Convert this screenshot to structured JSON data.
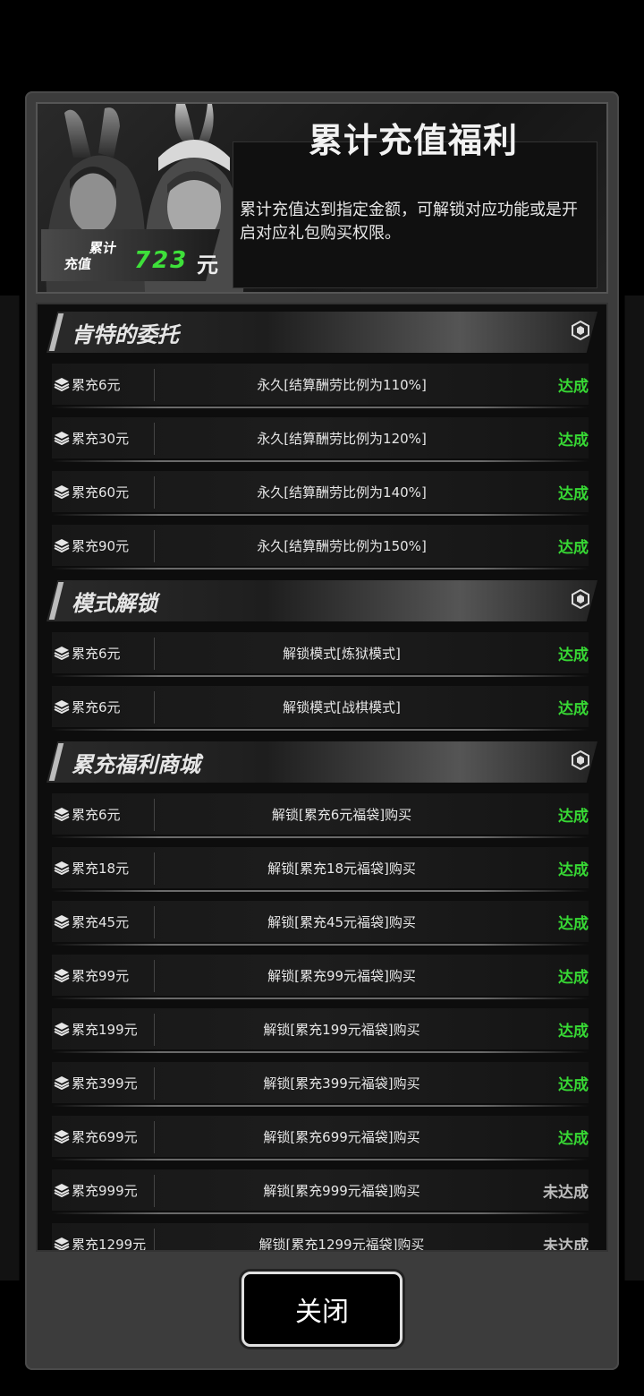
{
  "header": {
    "title": "累计充值福利",
    "description": "累计充值达到指定金额，可解锁对应功能或是开启对应礼包购买权限。",
    "badge_label_top": "累计",
    "badge_label_bottom": "充值",
    "badge_value": "723",
    "badge_unit": "元"
  },
  "sections": [
    {
      "title": "肯特的委托",
      "rows": [
        {
          "req": "累充6元",
          "desc": "永久[结算酬劳比例为110%]",
          "status": "达成",
          "done": true
        },
        {
          "req": "累充30元",
          "desc": "永久[结算酬劳比例为120%]",
          "status": "达成",
          "done": true
        },
        {
          "req": "累充60元",
          "desc": "永久[结算酬劳比例为140%]",
          "status": "达成",
          "done": true
        },
        {
          "req": "累充90元",
          "desc": "永久[结算酬劳比例为150%]",
          "status": "达成",
          "done": true
        }
      ]
    },
    {
      "title": "模式解锁",
      "rows": [
        {
          "req": "累充6元",
          "desc": "解锁模式[炼狱模式]",
          "status": "达成",
          "done": true
        },
        {
          "req": "累充6元",
          "desc": "解锁模式[战棋模式]",
          "status": "达成",
          "done": true
        }
      ]
    },
    {
      "title": "累充福利商城",
      "rows": [
        {
          "req": "累充6元",
          "desc": "解锁[累充6元福袋]购买",
          "status": "达成",
          "done": true
        },
        {
          "req": "累充18元",
          "desc": "解锁[累充18元福袋]购买",
          "status": "达成",
          "done": true
        },
        {
          "req": "累充45元",
          "desc": "解锁[累充45元福袋]购买",
          "status": "达成",
          "done": true
        },
        {
          "req": "累充99元",
          "desc": "解锁[累充99元福袋]购买",
          "status": "达成",
          "done": true
        },
        {
          "req": "累充199元",
          "desc": "解锁[累充199元福袋]购买",
          "status": "达成",
          "done": true
        },
        {
          "req": "累充399元",
          "desc": "解锁[累充399元福袋]购买",
          "status": "达成",
          "done": true
        },
        {
          "req": "累充699元",
          "desc": "解锁[累充699元福袋]购买",
          "status": "达成",
          "done": true
        },
        {
          "req": "累充999元",
          "desc": "解锁[累充999元福袋]购买",
          "status": "未达成",
          "done": false
        },
        {
          "req": "累充1299元",
          "desc": "解锁[累充1299元福袋]购买",
          "status": "未达成",
          "done": false
        }
      ]
    }
  ],
  "close_label": "关闭",
  "colors": {
    "achieved": "#37d834",
    "not_achieved": "#bdbdbd",
    "amount": "#3ee03a"
  },
  "icons": {
    "section": "hexagon-icon",
    "row": "stack-icon"
  }
}
